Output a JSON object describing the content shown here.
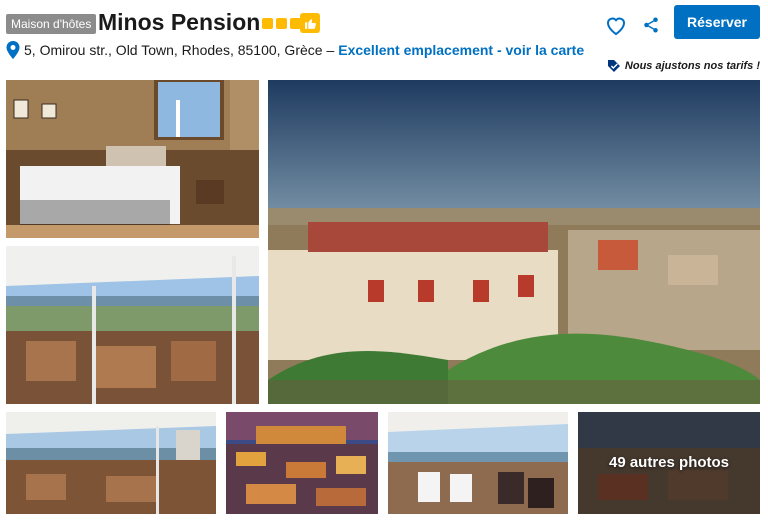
{
  "header": {
    "property_type": "Maison d'hôtes",
    "title": "Minos Pension",
    "stars": 3,
    "reserve_label": "Réserver"
  },
  "address": {
    "text": "5, Omirou str., Old Town, Rhodes, 85100, Grèce –",
    "location_link": "Excellent emplacement - voir la carte"
  },
  "price_note": "Nous ajustons nos tarifs !",
  "gallery": {
    "more_photos_label": "49 autres photos"
  },
  "colors": {
    "accent": "#0071c2",
    "stars": "#febb02",
    "badge": "#8c8c8c"
  },
  "icons": [
    "map-pin-icon",
    "heart-icon",
    "share-icon",
    "thumbs-up-icon",
    "price-tag-icon"
  ]
}
